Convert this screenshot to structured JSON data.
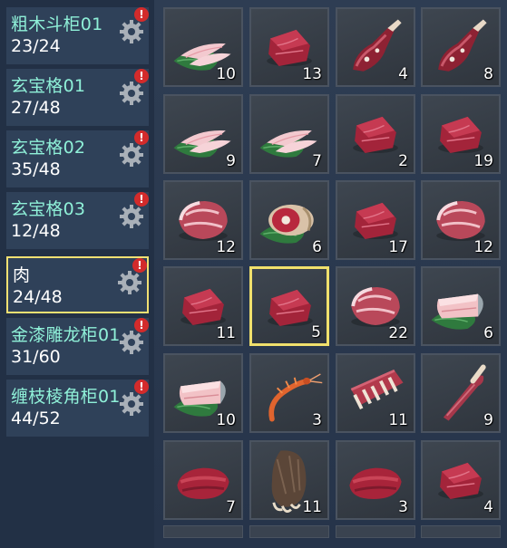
{
  "cabinets": [
    {
      "name": "粗木斗柜01",
      "count": "23/24",
      "selected": false
    },
    {
      "name": "玄宝格01",
      "count": "27/48",
      "selected": false
    },
    {
      "name": "玄宝格02",
      "count": "35/48",
      "selected": false
    },
    {
      "name": "玄宝格03",
      "count": "12/48",
      "selected": false
    },
    {
      "name": "肉",
      "count": "24/48",
      "selected": true
    },
    {
      "name": "金漆雕龙柜01",
      "count": "31/60",
      "selected": false
    },
    {
      "name": "缠枝棱角柜01",
      "count": "44/52",
      "selected": false
    }
  ],
  "alert_symbol": "!",
  "items": [
    {
      "icon": "fish-fillet-icon",
      "qty": "10"
    },
    {
      "icon": "meat-block-icon",
      "qty": "13"
    },
    {
      "icon": "meat-leg-icon",
      "qty": "4"
    },
    {
      "icon": "meat-leg-icon",
      "qty": "8"
    },
    {
      "icon": "fish-fillet-icon",
      "qty": "9"
    },
    {
      "icon": "fish-fillet-icon",
      "qty": "7"
    },
    {
      "icon": "meat-block-icon",
      "qty": "2"
    },
    {
      "icon": "meat-block-icon",
      "qty": "19"
    },
    {
      "icon": "pork-haunch-icon",
      "qty": "12"
    },
    {
      "icon": "ham-icon",
      "qty": "6"
    },
    {
      "icon": "meat-block-icon",
      "qty": "17"
    },
    {
      "icon": "pork-haunch-icon",
      "qty": "12"
    },
    {
      "icon": "meat-block-icon",
      "qty": "11"
    },
    {
      "icon": "meat-block-icon",
      "qty": "5",
      "selected": true
    },
    {
      "icon": "pork-haunch-icon",
      "qty": "22"
    },
    {
      "icon": "fish-steak-icon",
      "qty": "6"
    },
    {
      "icon": "fish-steak-icon",
      "qty": "10"
    },
    {
      "icon": "shrimp-icon",
      "qty": "3"
    },
    {
      "icon": "ribs-icon",
      "qty": "11"
    },
    {
      "icon": "bone-leg-icon",
      "qty": "9"
    },
    {
      "icon": "steak-icon",
      "qty": "7"
    },
    {
      "icon": "bear-paw-icon",
      "qty": "11"
    },
    {
      "icon": "steak-icon",
      "qty": "3"
    },
    {
      "icon": "meat-block-icon",
      "qty": "4"
    }
  ],
  "colors": {
    "accent_teal": "#8ff0d8",
    "selection_yellow": "#f0e06c",
    "alert_red": "#d32b2b"
  }
}
